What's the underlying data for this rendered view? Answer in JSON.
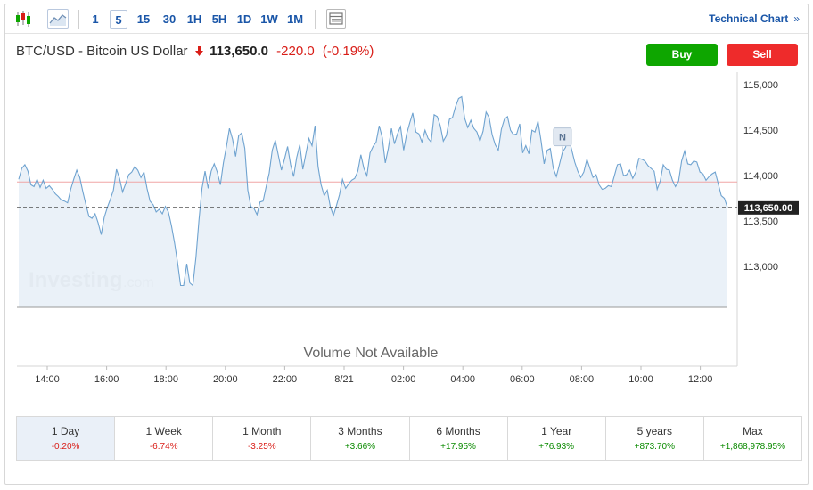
{
  "toolbar": {
    "timeframes": [
      "1",
      "5",
      "15",
      "30",
      "1H",
      "5H",
      "1D",
      "1W",
      "1M"
    ],
    "active_timeframe": "5",
    "technical_chart_label": "Technical Chart",
    "technical_chart_arrow": "»"
  },
  "instrument": {
    "name": "BTC/USD - Bitcoin US Dollar",
    "direction_icon": "arrow-down",
    "price": "113,650.0",
    "change": "-220.0",
    "change_pct": "(-0.19%)"
  },
  "actions": {
    "buy_label": "Buy",
    "sell_label": "Sell"
  },
  "chart_data": {
    "type": "area",
    "x_tick_labels": [
      "14:00",
      "16:00",
      "18:00",
      "20:00",
      "22:00",
      "8/21",
      "02:00",
      "04:00",
      "06:00",
      "08:00",
      "10:00",
      "12:00"
    ],
    "y_tick_labels": [
      "115,000",
      "114,500",
      "114,000",
      "113,500",
      "113,000"
    ],
    "y_tick_values": [
      115000,
      114500,
      114000,
      113500,
      113000
    ],
    "ylim": [
      112550,
      115100
    ],
    "previous_close": 113930,
    "last_price": 113650,
    "last_price_label": "113,650.00",
    "news_marker_label": "N",
    "news_marker_time_index": 178,
    "watermark": "Investing",
    "watermark_suffix": ".com",
    "volume_note": "Volume Not Available",
    "colors": {
      "line": "#6fa3d0",
      "fill": "#e6eef7",
      "prev_close": "#f0a6a6",
      "label_bg": "#222222"
    },
    "series": [
      {
        "values": [
          113960,
          114080,
          114120,
          114050,
          113900,
          113880,
          113960,
          113870,
          113950,
          113860,
          113890,
          113850,
          113800,
          113770,
          113730,
          113720,
          113700,
          113850,
          113960,
          114060,
          113980,
          113820,
          113680,
          113550,
          113530,
          113580,
          113480,
          113350,
          113540,
          113650,
          113740,
          113840,
          114070,
          113970,
          113820,
          113910,
          114010,
          114040,
          114100,
          114060,
          113980,
          114040,
          113860,
          113720,
          113680,
          113600,
          113630,
          113580,
          113660,
          113600,
          113450,
          113260,
          113040,
          112790,
          112790,
          113030,
          112820,
          112790,
          113100,
          113510,
          113860,
          114050,
          113860,
          114050,
          114130,
          114040,
          113900,
          114140,
          114320,
          114520,
          114400,
          114210,
          114440,
          114470,
          114300,
          113840,
          113660,
          113640,
          113570,
          113710,
          113720,
          113880,
          114030,
          114280,
          114390,
          114220,
          114060,
          114180,
          114320,
          114120,
          113990,
          114200,
          114340,
          114070,
          114240,
          114410,
          114330,
          114550,
          114100,
          113900,
          113780,
          113840,
          113660,
          113560,
          113670,
          113790,
          113960,
          113860,
          113910,
          113950,
          113970,
          114050,
          114230,
          114080,
          114000,
          114250,
          114320,
          114370,
          114550,
          114420,
          114140,
          114300,
          114520,
          114350,
          114460,
          114540,
          114280,
          114460,
          114580,
          114690,
          114480,
          114460,
          114370,
          114500,
          114410,
          114370,
          114670,
          114650,
          114550,
          114380,
          114440,
          114620,
          114640,
          114760,
          114850,
          114870,
          114630,
          114530,
          114610,
          114520,
          114480,
          114380,
          114490,
          114700,
          114640,
          114450,
          114340,
          114280,
          114510,
          114620,
          114650,
          114500,
          114450,
          114460,
          114570,
          114250,
          114330,
          114240,
          114500,
          114480,
          114600,
          114380,
          114130,
          114280,
          114300,
          114080,
          113990,
          114120,
          114260,
          114310,
          114420,
          114290,
          114150,
          114050,
          113980,
          114040,
          114180,
          114080,
          113980,
          114010,
          113900,
          113850,
          113860,
          113890,
          113880,
          114000,
          114120,
          114130,
          114000,
          114010,
          114060,
          113970,
          114040,
          114190,
          114180,
          114160,
          114110,
          114080,
          114050,
          113850,
          113940,
          114120,
          114070,
          114060,
          113950,
          113880,
          113940,
          114160,
          114270,
          114130,
          114120,
          114160,
          114150,
          114040,
          114020,
          113950,
          113990,
          114020,
          114040,
          113910,
          113780,
          113750,
          113650
        ]
      }
    ]
  }
}
